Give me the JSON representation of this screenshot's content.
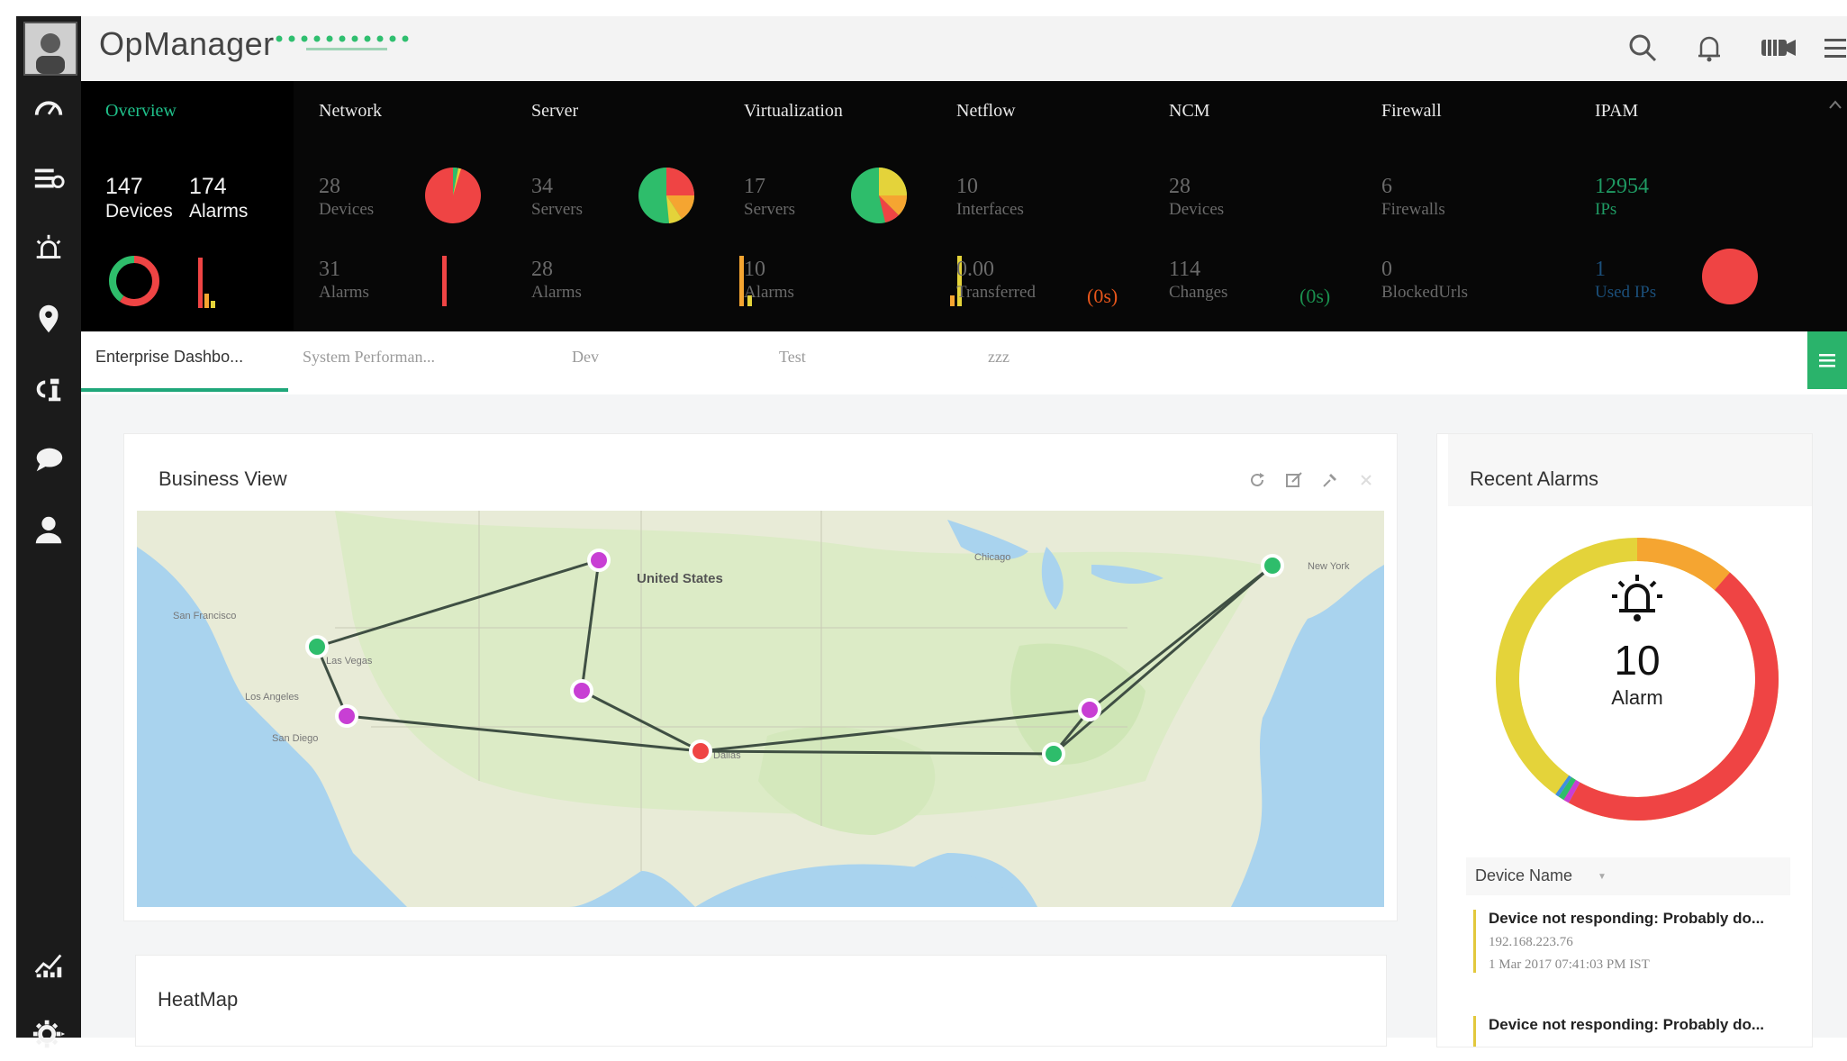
{
  "app": {
    "title": "OpManager"
  },
  "header_icons": [
    "search-icon",
    "bell-icon",
    "camera-icon",
    "menu-icon"
  ],
  "sidebar": {
    "items": [
      {
        "icon": "dashboard-gauge-icon"
      },
      {
        "icon": "inventory-list-icon"
      },
      {
        "icon": "alarm-bug-icon"
      },
      {
        "icon": "map-pin-icon"
      },
      {
        "icon": "workflow-icon"
      },
      {
        "icon": "chat-icon"
      },
      {
        "icon": "user-icon"
      },
      {
        "icon": "reports-chart-icon"
      },
      {
        "icon": "settings-gear-icon"
      }
    ]
  },
  "categories": [
    {
      "label": "Overview"
    },
    {
      "label": "Network"
    },
    {
      "label": "Server"
    },
    {
      "label": "Virtualization"
    },
    {
      "label": "Netflow"
    },
    {
      "label": "NCM"
    },
    {
      "label": "Firewall"
    },
    {
      "label": "IPAM"
    }
  ],
  "overview": {
    "devices": {
      "value": "147",
      "label": "Devices"
    },
    "alarms": {
      "value": "174",
      "label": "Alarms"
    }
  },
  "metrics": {
    "network": {
      "top_value": "28",
      "top_label": "Devices",
      "bottom_value": "31",
      "bottom_label": "Alarms"
    },
    "server": {
      "top_value": "34",
      "top_label": "Servers",
      "bottom_value": "28",
      "bottom_label": "Alarms"
    },
    "virtualization": {
      "top_value": "17",
      "top_label": "Servers",
      "bottom_value": "10",
      "bottom_label": "Alarms"
    },
    "netflow": {
      "top_value": "10",
      "top_label": "Interfaces",
      "bottom_value": "0.00",
      "bottom_label": "Transferred",
      "badge": "(0s)"
    },
    "ncm": {
      "top_value": "28",
      "top_label": "Devices",
      "bottom_value": "114",
      "bottom_label": "Changes",
      "badge": "(0s)"
    },
    "firewall": {
      "top_value": "6",
      "top_label": "Firewalls",
      "bottom_value": "0",
      "bottom_label": "BlockedUrls"
    },
    "ipam": {
      "top_value": "12954",
      "top_label": "IPs",
      "bottom_value": "1",
      "bottom_label": "Used IPs"
    }
  },
  "tabs": [
    {
      "label": "Enterprise Dashbo...",
      "active": true
    },
    {
      "label": "System Performan..."
    },
    {
      "label": "Dev"
    },
    {
      "label": "Test"
    },
    {
      "label": "zzz"
    }
  ],
  "business_view": {
    "title": "Business View",
    "map_labels": {
      "country": "United States",
      "cities": [
        "San Francisco",
        "Las Vegas",
        "Los Angeles",
        "San Diego",
        "New York",
        "Chicago",
        "Dallas"
      ]
    }
  },
  "heatmap": {
    "title": "HeatMap"
  },
  "recent_alarms": {
    "title": "Recent Alarms",
    "count": "10",
    "count_label": "Alarm",
    "column_header": "Device Name",
    "items": [
      {
        "title": "Device not responding: Probably do...",
        "ip": "192.168.223.76",
        "time": "1 Mar 2017 07:41:03 PM IST"
      },
      {
        "title": "Device not responding: Probably do..."
      }
    ]
  },
  "colors": {
    "accent_green": "#1fc08a",
    "critical": "#ef4444",
    "warning": "#f5a531",
    "minor": "#e4d33a",
    "ok": "#2ebd6b"
  }
}
